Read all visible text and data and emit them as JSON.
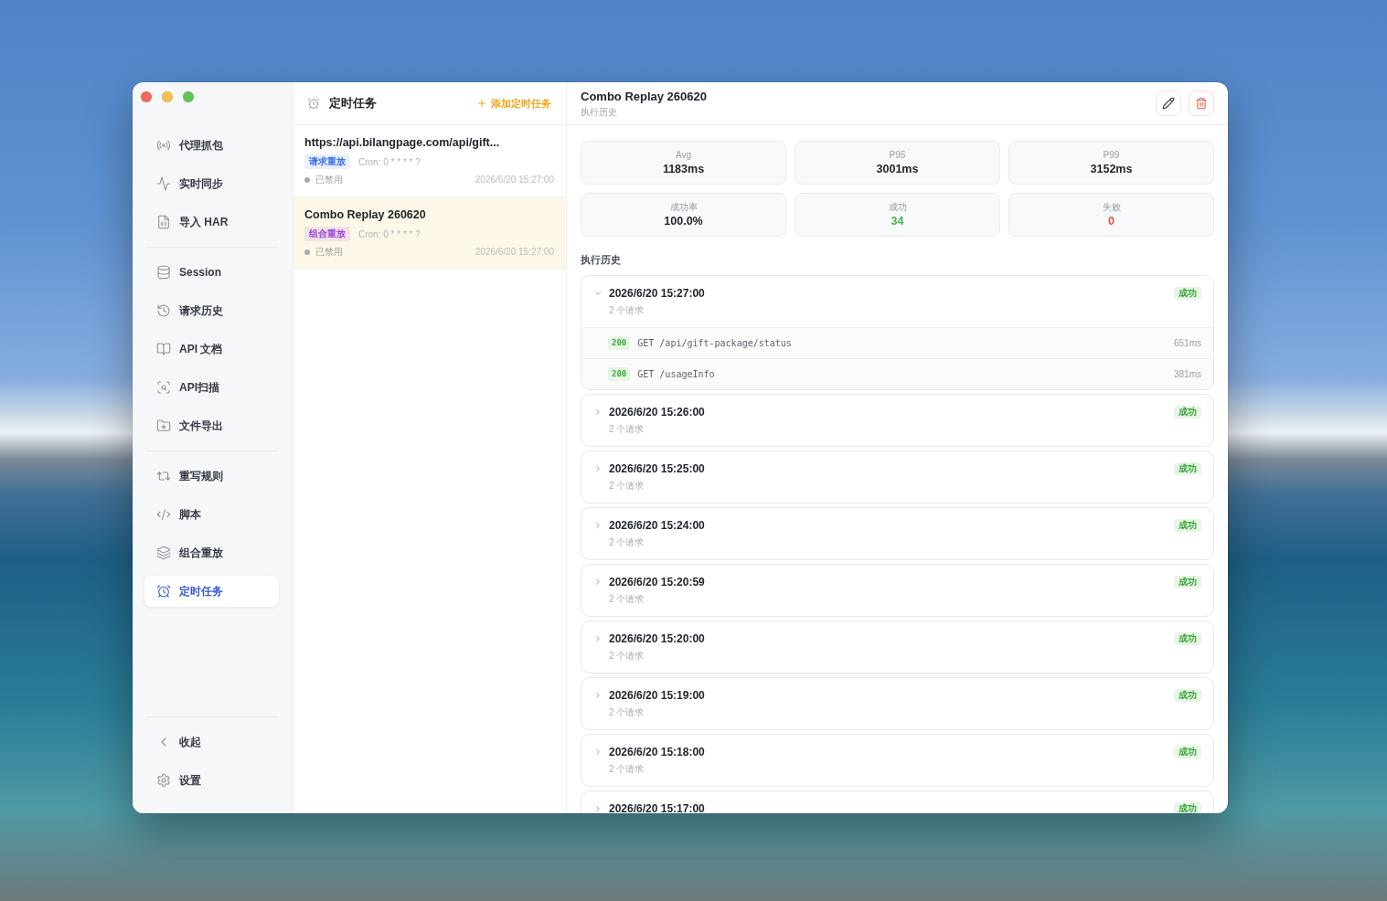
{
  "sidebar": {
    "sections": [
      {
        "items": [
          {
            "label": "代理抓包",
            "selected": false
          },
          {
            "label": "实时同步",
            "selected": false
          },
          {
            "label": "导入 HAR",
            "selected": false
          }
        ]
      },
      {
        "items": [
          {
            "label": "Session",
            "selected": false
          },
          {
            "label": "请求历史",
            "selected": false
          },
          {
            "label": "API 文档",
            "selected": false
          },
          {
            "label": "API扫描",
            "selected": false
          },
          {
            "label": "文件导出",
            "selected": false
          }
        ]
      },
      {
        "items": [
          {
            "label": "重写规则",
            "selected": false
          },
          {
            "label": "脚本",
            "selected": false
          },
          {
            "label": "组合重放",
            "selected": false
          },
          {
            "label": "定时任务",
            "selected": true
          }
        ]
      }
    ],
    "footer_items": [
      {
        "label": "收起"
      },
      {
        "label": "设置"
      }
    ]
  },
  "task_list": {
    "title": "定时任务",
    "add_label": "添加定时任务",
    "items": [
      {
        "title": "https://api.bilangpage.com/api/gift...",
        "tag": {
          "label": "请求重放",
          "color": "#3b6ee8"
        },
        "cron": "Cron: 0 * * * * ?",
        "enabled": false,
        "status": "已禁用",
        "time": "2026/6/20 15:27:00",
        "selected": false
      },
      {
        "title": "Combo Replay 260620",
        "tag": {
          "label": "组合重放",
          "color": "#9b45e0"
        },
        "cron": "Cron: 0 * * * * ?",
        "enabled": false,
        "status": "已禁用",
        "time": "2026/6/20 15:27:00",
        "selected": true
      }
    ]
  },
  "detail": {
    "title": "Combo Replay 260620",
    "subtitle": "执行历史",
    "stats": [
      {
        "label": "Avg",
        "value": "1183ms",
        "kind": "plain"
      },
      {
        "label": "P95",
        "value": "3001ms",
        "kind": "plain"
      },
      {
        "label": "P99",
        "value": "3152ms",
        "kind": "plain"
      },
      {
        "label": "成功率",
        "value": "100.0%",
        "kind": "plain"
      },
      {
        "label": "成功",
        "value": "34",
        "kind": "success"
      },
      {
        "label": "失败",
        "value": "0",
        "kind": "failure"
      }
    ],
    "history_title": "执行历史",
    "runs": [
      {
        "time": "2026/6/20 15:27:00",
        "count": "2 个请求",
        "status": "成功",
        "expanded": true,
        "requests": [
          {
            "code": "200",
            "line": "GET /api/gift-package/status",
            "duration": "651ms"
          },
          {
            "code": "200",
            "line": "GET /usageInfo",
            "duration": "381ms"
          }
        ]
      },
      {
        "time": "2026/6/20 15:26:00",
        "count": "2 个请求",
        "status": "成功",
        "expanded": false
      },
      {
        "time": "2026/6/20 15:25:00",
        "count": "2 个请求",
        "status": "成功",
        "expanded": false
      },
      {
        "time": "2026/6/20 15:24:00",
        "count": "2 个请求",
        "status": "成功",
        "expanded": false
      },
      {
        "time": "2026/6/20 15:20:59",
        "count": "2 个请求",
        "status": "成功",
        "expanded": false
      },
      {
        "time": "2026/6/20 15:20:00",
        "count": "2 个请求",
        "status": "成功",
        "expanded": false
      },
      {
        "time": "2026/6/20 15:19:00",
        "count": "2 个请求",
        "status": "成功",
        "expanded": false
      },
      {
        "time": "2026/6/20 15:18:00",
        "count": "2 个请求",
        "status": "成功",
        "expanded": false
      },
      {
        "time": "2026/6/20 15:17:00",
        "status": "成功",
        "expanded": false
      }
    ]
  }
}
